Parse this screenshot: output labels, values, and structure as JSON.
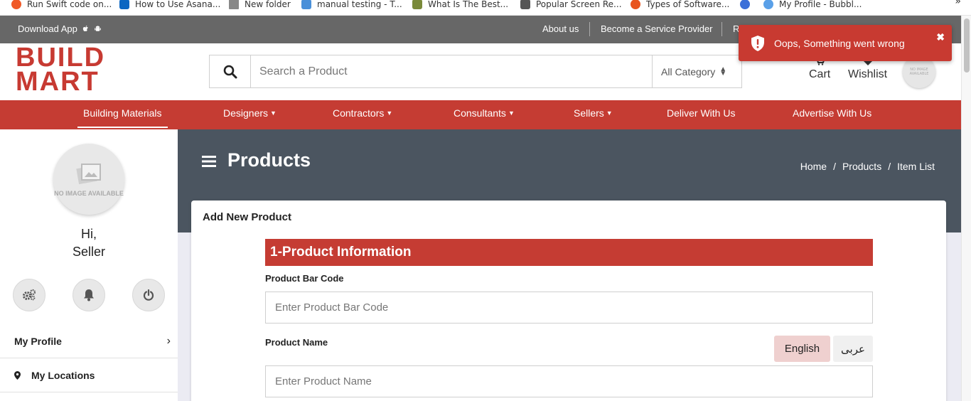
{
  "bookmarks": [
    {
      "label": "Run Swift code on...",
      "icon": "swift-icon",
      "color": "#f05a28"
    },
    {
      "label": "How to Use Asana...",
      "icon": "linkedin-icon",
      "color": "#0a66c2"
    },
    {
      "label": "New folder",
      "icon": "folder-icon",
      "color": "#888888"
    },
    {
      "label": "manual testing - T...",
      "icon": "site-icon",
      "color": "#4a90d9"
    },
    {
      "label": "What Is The Best...",
      "icon": "site-icon",
      "color": "#7a8a3a"
    },
    {
      "label": "Popular Screen Re...",
      "icon": "site-icon",
      "color": "#555555"
    },
    {
      "label": "Types of Software...",
      "icon": "site-icon",
      "color": "#e8541e"
    },
    {
      "label": "",
      "icon": "history-icon",
      "color": "#3b6fd8"
    },
    {
      "label": "My Profile - Bubbl...",
      "icon": "bubble-icon",
      "color": "#5aa0e8"
    }
  ],
  "bookmarks_more": "»",
  "topbar": {
    "download": "Download App",
    "about": "About us",
    "become": "Become a Service Provider",
    "partial": "R"
  },
  "logo": {
    "line1": "BUILD",
    "line2": "MART"
  },
  "search": {
    "placeholder": "Search a Product",
    "category": "All Category"
  },
  "header": {
    "cart": "Cart",
    "wishlist": "Wishlist",
    "avatar_text": "NO IMAGE AVAILABLE"
  },
  "toast": {
    "message": "Oops, Something went wrong",
    "close": "✖"
  },
  "nav": {
    "building": "Building Materials",
    "designers": "Designers",
    "contractors": "Contractors",
    "consultants": "Consultants",
    "sellers": "Sellers",
    "deliver": "Deliver With Us",
    "advertise": "Advertise With Us"
  },
  "sidebar": {
    "avatar_text": "NO IMAGE AVAILABLE",
    "greeting_line1": "Hi,",
    "greeting_line2": "Seller",
    "my_profile": "My Profile",
    "my_profile_arrow": "›",
    "my_locations": "My Locations"
  },
  "banner": {
    "title": "Products",
    "crumb_home": "Home",
    "crumb_products": "Products",
    "crumb_item_list": "Item List",
    "sep": "/"
  },
  "form": {
    "card_title": "Add New Product",
    "section_title": "1-Product Information",
    "barcode_label": "Product Bar Code",
    "barcode_placeholder": "Enter Product Bar Code",
    "name_label": "Product Name",
    "name_placeholder": "Enter Product Name",
    "lang_english": "English",
    "lang_arabic": "عربى"
  },
  "colors": {
    "brand_red": "#c53c33",
    "banner_slate": "#4b5560",
    "topbar_grey": "#676767"
  }
}
